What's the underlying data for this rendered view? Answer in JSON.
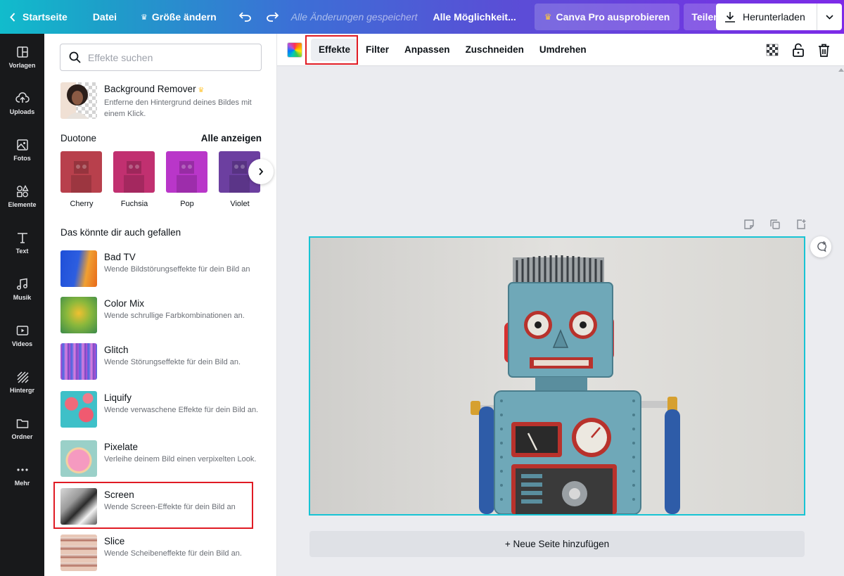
{
  "topbar": {
    "home": "Startseite",
    "file": "Datei",
    "resize": "Größe ändern",
    "saved": "Alle Änderungen gespeichert",
    "all_options": "Alle Möglichkeit...",
    "pro": "Canva Pro ausprobieren",
    "share": "Teilen",
    "download": "Herunterladen"
  },
  "rail": [
    {
      "label": "Vorlagen",
      "icon": "templates-icon"
    },
    {
      "label": "Uploads",
      "icon": "upload-cloud-icon"
    },
    {
      "label": "Fotos",
      "icon": "photo-icon"
    },
    {
      "label": "Elemente",
      "icon": "shapes-icon"
    },
    {
      "label": "Text",
      "icon": "text-icon"
    },
    {
      "label": "Musik",
      "icon": "music-icon"
    },
    {
      "label": "Videos",
      "icon": "video-icon"
    },
    {
      "label": "Hintergr",
      "icon": "background-icon"
    },
    {
      "label": "Ordner",
      "icon": "folder-icon"
    },
    {
      "label": "Mehr",
      "icon": "more-icon"
    }
  ],
  "panel": {
    "search_placeholder": "Effekte suchen",
    "bg_remover": {
      "title": "Background Remover",
      "desc": "Entferne den Hintergrund deines Bildes mit einem Klick."
    },
    "duotone": {
      "heading": "Duotone",
      "see_all": "Alle anzeigen",
      "items": [
        {
          "label": "Cherry",
          "color": "#b8404c"
        },
        {
          "label": "Fuchsia",
          "color": "#c13070"
        },
        {
          "label": "Pop",
          "color": "#b936c9"
        },
        {
          "label": "Violet",
          "color": "#6c3fa0"
        }
      ]
    },
    "suggest_heading": "Das könnte dir auch gefallen",
    "effects": [
      {
        "title": "Bad TV",
        "desc": "Wende Bildstörungseffekte für dein Bild an"
      },
      {
        "title": "Color Mix",
        "desc": "Wende schrullige Farbkombinationen an."
      },
      {
        "title": "Glitch",
        "desc": "Wende Störungseffekte für dein Bild an."
      },
      {
        "title": "Liquify",
        "desc": "Wende verwaschene Effekte für dein Bild an."
      },
      {
        "title": "Pixelate",
        "desc": "Verleihe deinem Bild einen verpixelten Look."
      },
      {
        "title": "Screen",
        "desc": "Wende Screen-Effekte für dein Bild an"
      },
      {
        "title": "Slice",
        "desc": "Wende Scheibeneffekte für dein Bild an."
      }
    ]
  },
  "toolbar": {
    "effects": "Effekte",
    "filter": "Filter",
    "adjust": "Anpassen",
    "crop": "Zuschneiden",
    "flip": "Umdrehen"
  },
  "canvas": {
    "add_page": "+ Neue Seite hinzufügen"
  },
  "colors": {
    "accent_border": "#17c4d4",
    "highlight": "#e01b24",
    "crown": "#ffc83d"
  }
}
